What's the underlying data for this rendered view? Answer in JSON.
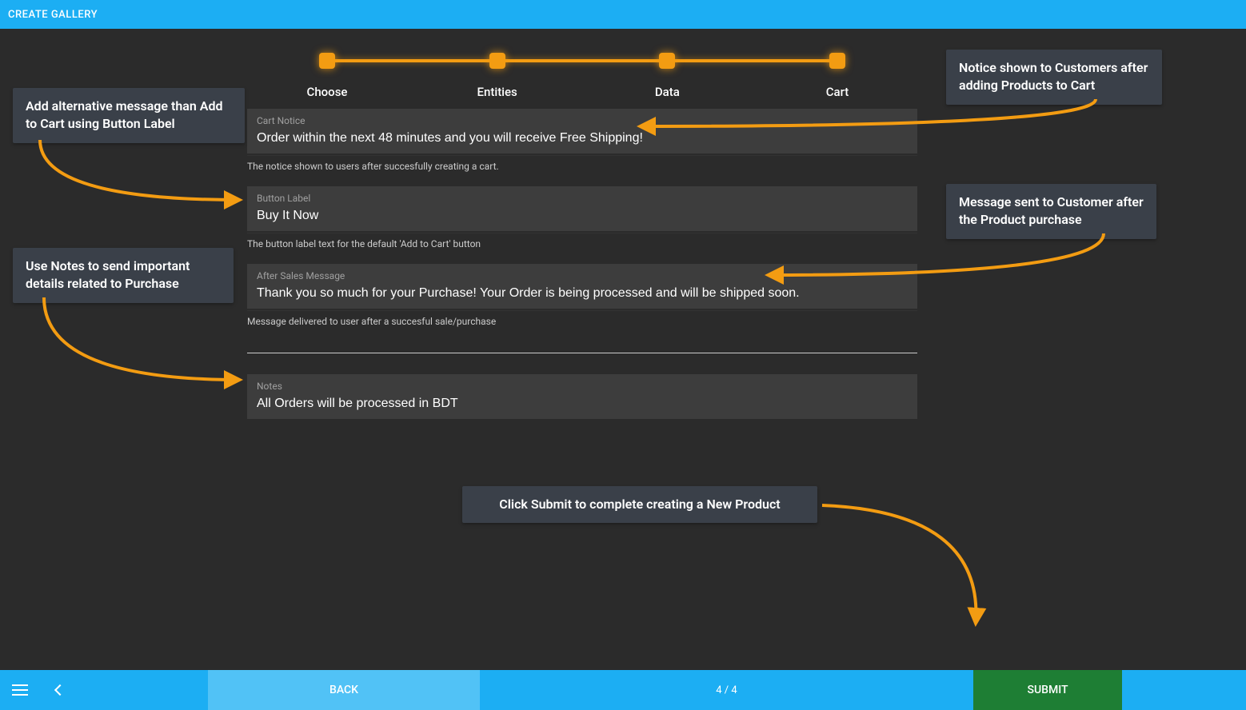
{
  "header": {
    "title": "CREATE GALLERY"
  },
  "stepper": {
    "steps": [
      {
        "label": "Choose"
      },
      {
        "label": "Entities"
      },
      {
        "label": "Data"
      },
      {
        "label": "Cart"
      }
    ]
  },
  "fields": {
    "cart_notice": {
      "label": "Cart Notice",
      "value": "Order within the next 48 minutes and you will receive Free Shipping!",
      "helper": "The notice shown to users after succesfully creating a cart."
    },
    "button_label": {
      "label": "Button Label",
      "value": "Buy It Now",
      "helper": "The button label text for the default 'Add to Cart' button"
    },
    "after_sales": {
      "label": "After Sales Message",
      "value": "Thank you so much for your Purchase! Your Order is being processed and will be shipped soon.",
      "helper": "Message delivered to user after a succesful sale/purchase"
    },
    "notes": {
      "label": "Notes",
      "value": "All Orders will be processed in BDT"
    }
  },
  "footer": {
    "back_label": "BACK",
    "progress": "4 / 4",
    "submit_label": "SUBMIT"
  },
  "callouts": {
    "top_right": "Notice shown to Customers after adding Products to Cart",
    "top_left": "Add alternative message than Add to Cart using Button Label",
    "mid_right": "Message sent to Customer after the Product purchase",
    "mid_left": "Use Notes to send important details related to Purchase",
    "bottom_center": "Click Submit to complete creating a New Product"
  }
}
